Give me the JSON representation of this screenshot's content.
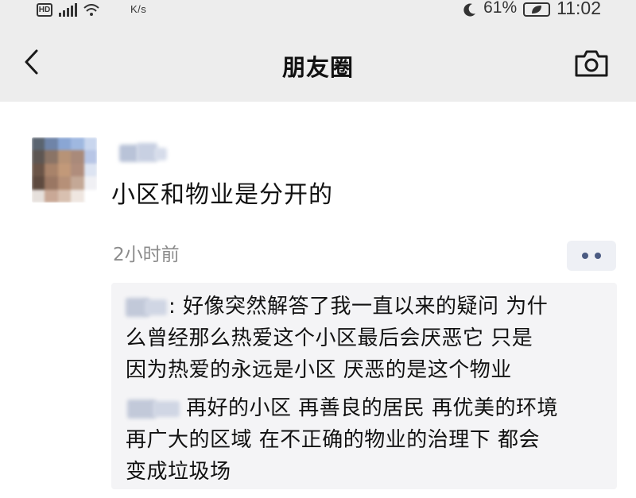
{
  "status_bar": {
    "hd_label": "HD",
    "net_speed": "K/s",
    "battery_percent": "61%",
    "time": "11:02"
  },
  "nav": {
    "title": "朋友圈",
    "back_icon": "chevron-left-icon",
    "camera_icon": "camera-icon"
  },
  "post": {
    "text": "小区和物业是分开的",
    "time_ago": "2小时前",
    "more_icon": "more-dots-icon"
  },
  "comments": [
    {
      "separator": ": ",
      "lines": [
        "好像突然解答了我一直以来的疑问 为什",
        "么曾经那么热爱这个小区最后会厌恶它 只是",
        "因为热爱的永远是小区 厌恶的是这个物业"
      ]
    },
    {
      "separator": "",
      "lines": [
        "再好的小区 再善良的居民 再优美的环境",
        "再广大的区域 在不正确的物业的治理下 都会",
        "变成垃圾场"
      ]
    }
  ],
  "colors": {
    "bar_bg": "#ededed",
    "link_blue": "#4b5b82",
    "time_gray": "#8c8c8c",
    "comment_bg": "#f4f4f6"
  }
}
